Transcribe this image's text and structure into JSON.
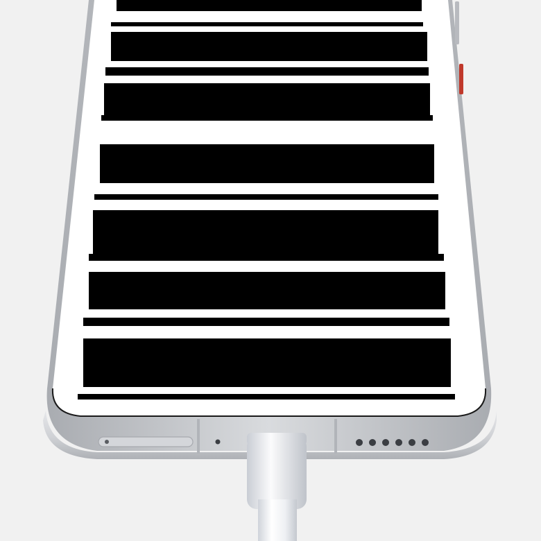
{
  "scene": {
    "subject": "phone-with-usb-c-cable",
    "background_color": "#f1f1f1",
    "frame_color": "#c9cbcf",
    "screen_color": "#ffffff",
    "redaction_color": "#000000",
    "side_button_color": "#c0392b",
    "cable_color": "#eef0f3"
  }
}
